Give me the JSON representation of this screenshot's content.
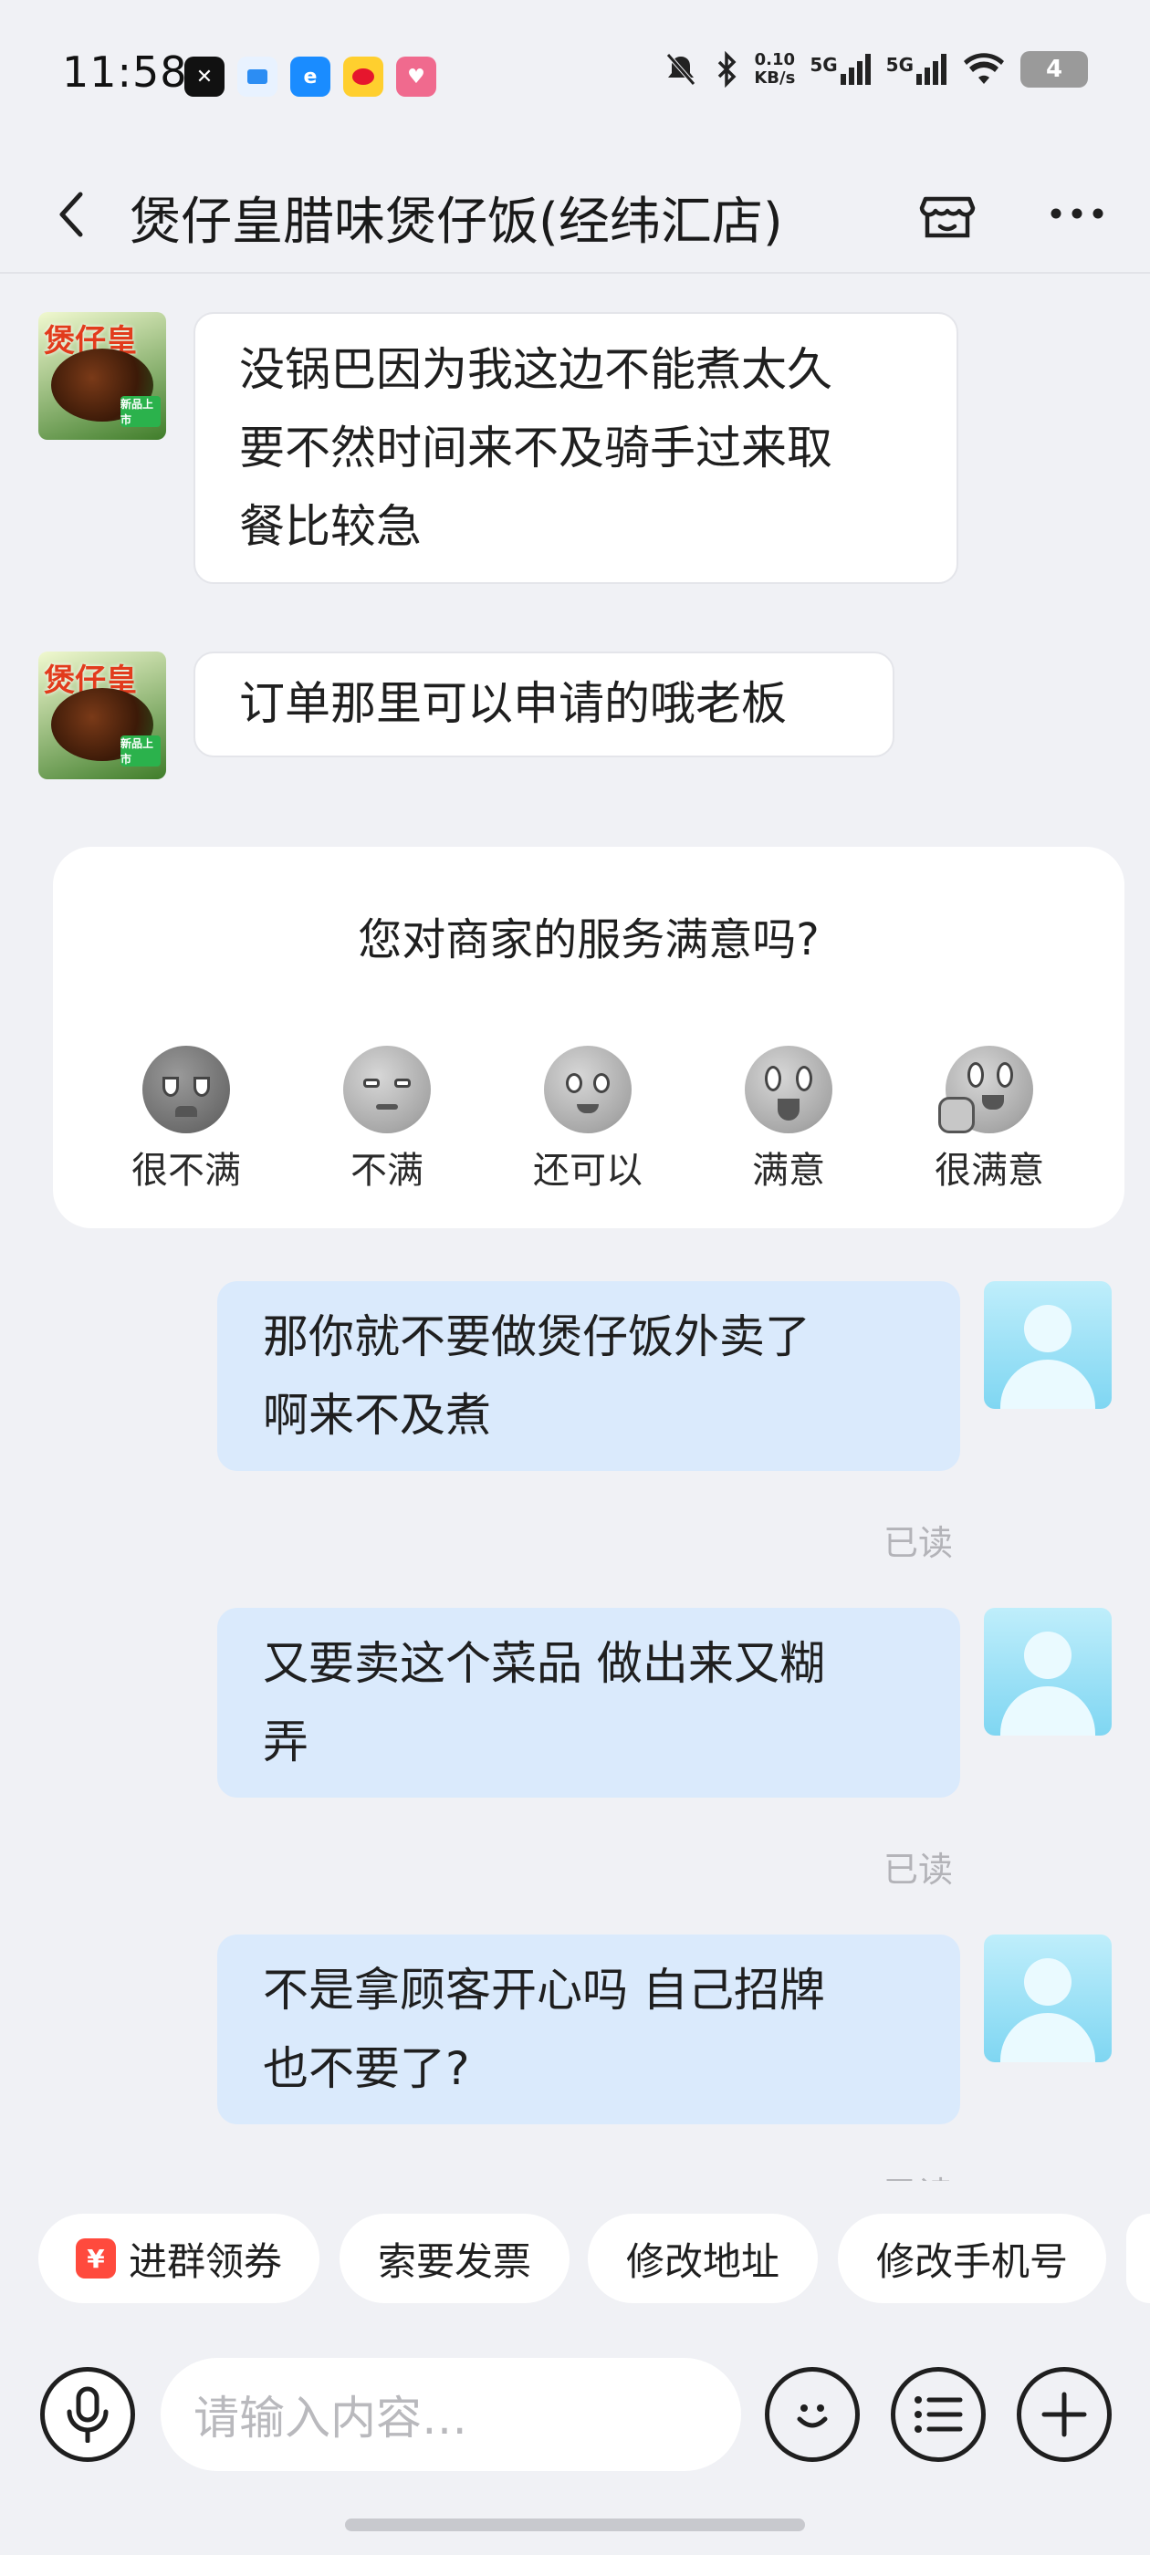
{
  "status_bar": {
    "time": "11:58",
    "net_speed_value": "0.10",
    "net_speed_unit": "KB/s",
    "sim1": "5G",
    "sim2": "5G",
    "battery": "4",
    "app_icons": [
      "capcut-icon",
      "bluelink-icon",
      "ele-me-icon",
      "weibo-icon",
      "xiaohongshu-icon"
    ]
  },
  "header": {
    "title": "煲仔皇腊味煲仔饭(经纬汇店)"
  },
  "shop_avatar": {
    "brand": "煲仔皇",
    "tag": "新品上市"
  },
  "messages": [
    {
      "from": "shop",
      "lines": [
        "没锅巴因为我这边不能煮太久",
        "要不然时间来不及骑手过来取",
        "餐比较急"
      ]
    },
    {
      "from": "shop",
      "lines": [
        "订单那里可以申请的哦老板"
      ]
    },
    {
      "from": "user",
      "lines": [
        "那你就不要做煲仔饭外卖了",
        "啊来不及煮"
      ],
      "status": "已读"
    },
    {
      "from": "user",
      "lines": [
        "又要卖这个菜品 做出来又糊",
        "弄"
      ],
      "status": "已读"
    },
    {
      "from": "user",
      "lines": [
        "不是拿顾客开心吗 自己招牌",
        "也不要了?"
      ],
      "status": "已读"
    }
  ],
  "rating": {
    "question": "您对商家的服务满意吗?",
    "options": [
      "很不满",
      "不满",
      "还可以",
      "满意",
      "很满意"
    ]
  },
  "quick_actions": [
    "进群领券",
    "索要发票",
    "修改地址",
    "修改手机号"
  ],
  "quick_action_icon_text": "¥",
  "input": {
    "placeholder": "请输入内容…"
  },
  "colors": {
    "background": "#f0f1f5",
    "user_bubble": "#daeafc",
    "shop_bubble": "#ffffff",
    "read_text": "#b3b3b8"
  }
}
